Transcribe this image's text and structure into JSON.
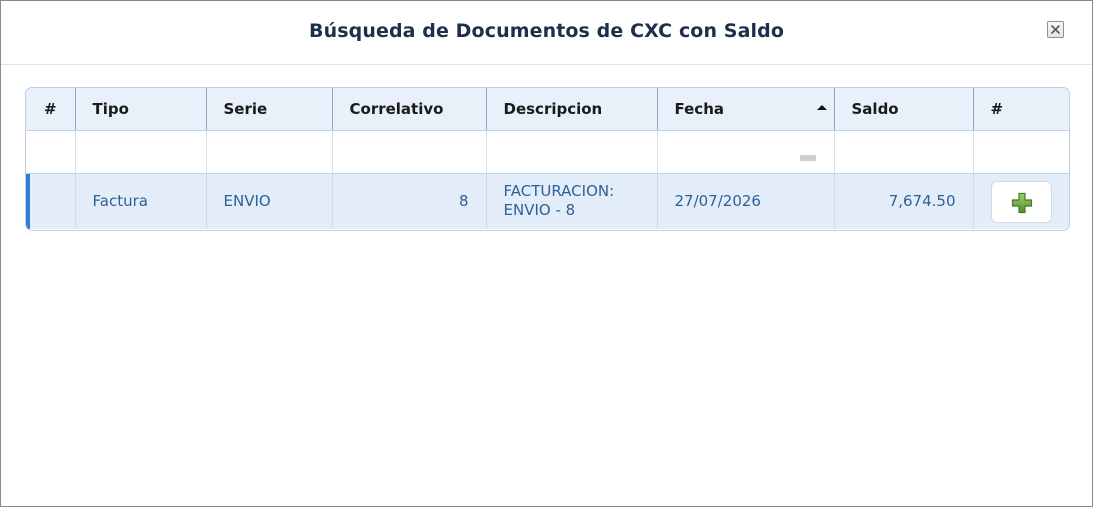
{
  "dialog": {
    "title": "Búsqueda de Documentos de CXC con Saldo"
  },
  "icons": {
    "close": "close-icon",
    "sort_ascending": "sort-ascending-icon",
    "filter_clear": "filter-dash-icon",
    "add": "plus-icon"
  },
  "colors": {
    "title": "#1d2f4a",
    "header_bg": "#e8f0fa",
    "row_selected_bg": "#e3edfa",
    "row_text": "#2e5f95",
    "selection_indicator": "#2f7fd0",
    "plus_icon_green": "#6aa83a"
  },
  "grid": {
    "columns": [
      {
        "key": "index",
        "label": "#"
      },
      {
        "key": "tipo",
        "label": "Tipo"
      },
      {
        "key": "serie",
        "label": "Serie"
      },
      {
        "key": "correlativo",
        "label": "Correlativo"
      },
      {
        "key": "descripcion",
        "label": "Descripcion"
      },
      {
        "key": "fecha",
        "label": "Fecha",
        "sorted": "ascending"
      },
      {
        "key": "saldo",
        "label": "Saldo"
      },
      {
        "key": "action",
        "label": "#"
      }
    ],
    "rows": [
      {
        "index": "",
        "tipo": "Factura",
        "serie": "ENVIO",
        "correlativo": "8",
        "descripcion": "FACTURACION: ENVIO - 8",
        "fecha": "27/07/2026",
        "saldo": "7,674.50",
        "selected": true
      }
    ]
  }
}
